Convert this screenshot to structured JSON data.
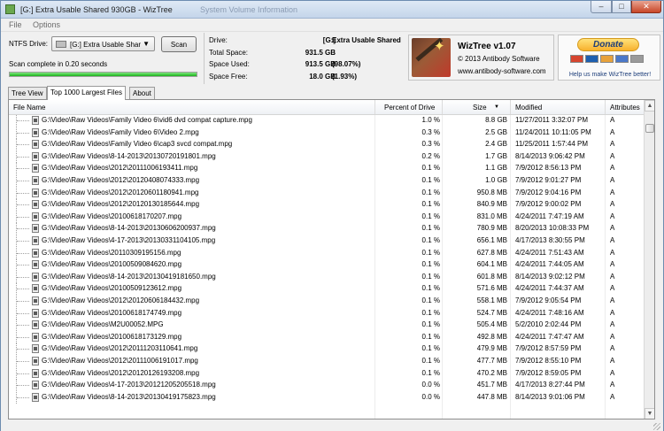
{
  "window": {
    "title": "[G:] Extra Usable Shared 930GB  -  WizTree",
    "ghost_title": "System Volume Information",
    "controls": {
      "minimize": "–",
      "maximize": "□",
      "close": "✕"
    }
  },
  "menu": {
    "items": [
      "File",
      "Options"
    ]
  },
  "scan_panel": {
    "drive_label": "NTFS Drive:",
    "drive_value": "[G:] Extra Usable Shar",
    "scan_button": "Scan",
    "status": "Scan complete in 0.20 seconds",
    "progress": 1.0,
    "progress_color": "#1bb21b"
  },
  "drive_info": {
    "drive": {
      "label": "Drive:",
      "value": "[G:]",
      "extra": "Extra Usable Shared"
    },
    "total": {
      "label": "Total Space:",
      "value": "931.5 GB"
    },
    "used": {
      "label": "Space Used:",
      "value": "913.5 GB",
      "pct": "(98.07%)"
    },
    "free": {
      "label": "Space Free:",
      "value": "18.0 GB",
      "pct": "(1.93%)"
    }
  },
  "about": {
    "version": "WizTree v1.07",
    "copyright": "© 2013 Antibody Software",
    "website": "www.antibody-software.com"
  },
  "donate": {
    "button": "Donate",
    "note": "Help us make WizTree better!",
    "card_colors": [
      "#d6452f",
      "#1d5fb0",
      "#e8a23a",
      "#4a78c9",
      "#9a9a9a"
    ]
  },
  "tabs": [
    {
      "label": "Tree View",
      "active": false
    },
    {
      "label": "Top 1000 Largest Files",
      "active": true
    },
    {
      "label": "About",
      "active": false
    }
  ],
  "table": {
    "columns": {
      "name": "File Name",
      "pct": "Percent of Drive",
      "size": "Size",
      "modified": "Modified",
      "attributes": "Attributes"
    },
    "sort_indicator": "▼",
    "rows": [
      {
        "name": "G:\\Video\\Raw Videos\\Family Video 6\\vid6 dvd compat capture.mpg",
        "pct": "1.0 %",
        "size": "8.8 GB",
        "modified": "11/27/2011 3:32:07 PM",
        "attr": "A"
      },
      {
        "name": "G:\\Video\\Raw Videos\\Family Video 6\\Video 2.mpg",
        "pct": "0.3 %",
        "size": "2.5 GB",
        "modified": "11/24/2011 10:11:05 PM",
        "attr": "A"
      },
      {
        "name": "G:\\Video\\Raw Videos\\Family Video 6\\cap3 svcd compat.mpg",
        "pct": "0.3 %",
        "size": "2.4 GB",
        "modified": "11/25/2011 1:57:44 PM",
        "attr": "A"
      },
      {
        "name": "G:\\Video\\Raw Videos\\8-14-2013\\20130720191801.mpg",
        "pct": "0.2 %",
        "size": "1.7 GB",
        "modified": "8/14/2013 9:06:42 PM",
        "attr": "A"
      },
      {
        "name": "G:\\Video\\Raw Videos\\2012\\20111006193411.mpg",
        "pct": "0.1 %",
        "size": "1.1 GB",
        "modified": "7/9/2012 8:56:13 PM",
        "attr": "A"
      },
      {
        "name": "G:\\Video\\Raw Videos\\2012\\20120408074333.mpg",
        "pct": "0.1 %",
        "size": "1.0 GB",
        "modified": "7/9/2012 9:01:27 PM",
        "attr": "A"
      },
      {
        "name": "G:\\Video\\Raw Videos\\2012\\20120601180941.mpg",
        "pct": "0.1 %",
        "size": "950.8 MB",
        "modified": "7/9/2012 9:04:16 PM",
        "attr": "A"
      },
      {
        "name": "G:\\Video\\Raw Videos\\2012\\20120130185644.mpg",
        "pct": "0.1 %",
        "size": "840.9 MB",
        "modified": "7/9/2012 9:00:02 PM",
        "attr": "A"
      },
      {
        "name": "G:\\Video\\Raw Videos\\20100618170207.mpg",
        "pct": "0.1 %",
        "size": "831.0 MB",
        "modified": "4/24/2011 7:47:19 AM",
        "attr": "A"
      },
      {
        "name": "G:\\Video\\Raw Videos\\8-14-2013\\20130606200937.mpg",
        "pct": "0.1 %",
        "size": "780.9 MB",
        "modified": "8/20/2013 10:08:33 PM",
        "attr": "A"
      },
      {
        "name": "G:\\Video\\Raw Videos\\4-17-2013\\20130331104105.mpg",
        "pct": "0.1 %",
        "size": "656.1 MB",
        "modified": "4/17/2013 8:30:55 PM",
        "attr": "A"
      },
      {
        "name": "G:\\Video\\Raw Videos\\20110309195156.mpg",
        "pct": "0.1 %",
        "size": "627.8 MB",
        "modified": "4/24/2011 7:51:43 AM",
        "attr": "A"
      },
      {
        "name": "G:\\Video\\Raw Videos\\20100509084620.mpg",
        "pct": "0.1 %",
        "size": "604.1 MB",
        "modified": "4/24/2011 7:44:05 AM",
        "attr": "A"
      },
      {
        "name": "G:\\Video\\Raw Videos\\8-14-2013\\20130419181650.mpg",
        "pct": "0.1 %",
        "size": "601.8 MB",
        "modified": "8/14/2013 9:02:12 PM",
        "attr": "A"
      },
      {
        "name": "G:\\Video\\Raw Videos\\20100509123612.mpg",
        "pct": "0.1 %",
        "size": "571.6 MB",
        "modified": "4/24/2011 7:44:37 AM",
        "attr": "A"
      },
      {
        "name": "G:\\Video\\Raw Videos\\2012\\20120606184432.mpg",
        "pct": "0.1 %",
        "size": "558.1 MB",
        "modified": "7/9/2012 9:05:54 PM",
        "attr": "A"
      },
      {
        "name": "G:\\Video\\Raw Videos\\20100618174749.mpg",
        "pct": "0.1 %",
        "size": "524.7 MB",
        "modified": "4/24/2011 7:48:16 AM",
        "attr": "A"
      },
      {
        "name": "G:\\Video\\Raw Videos\\M2U00052.MPG",
        "pct": "0.1 %",
        "size": "505.4 MB",
        "modified": "5/2/2010 2:02:44 PM",
        "attr": "A"
      },
      {
        "name": "G:\\Video\\Raw Videos\\20100618173129.mpg",
        "pct": "0.1 %",
        "size": "492.8 MB",
        "modified": "4/24/2011 7:47:47 AM",
        "attr": "A"
      },
      {
        "name": "G:\\Video\\Raw Videos\\2012\\20111203110641.mpg",
        "pct": "0.1 %",
        "size": "479.9 MB",
        "modified": "7/9/2012 8:57:59 PM",
        "attr": "A"
      },
      {
        "name": "G:\\Video\\Raw Videos\\2012\\20111006191017.mpg",
        "pct": "0.1 %",
        "size": "477.7 MB",
        "modified": "7/9/2012 8:55:10 PM",
        "attr": "A"
      },
      {
        "name": "G:\\Video\\Raw Videos\\2012\\20120126193208.mpg",
        "pct": "0.1 %",
        "size": "470.2 MB",
        "modified": "7/9/2012 8:59:05 PM",
        "attr": "A"
      },
      {
        "name": "G:\\Video\\Raw Videos\\4-17-2013\\20121205205518.mpg",
        "pct": "0.0 %",
        "size": "451.7 MB",
        "modified": "4/17/2013 8:27:44 PM",
        "attr": "A"
      },
      {
        "name": "G:\\Video\\Raw Videos\\8-14-2013\\20130419175823.mpg",
        "pct": "0.0 %",
        "size": "447.8 MB",
        "modified": "8/14/2013 9:01:06 PM",
        "attr": "A"
      }
    ]
  },
  "scrollbar": {
    "up": "▲",
    "down": "▼"
  }
}
